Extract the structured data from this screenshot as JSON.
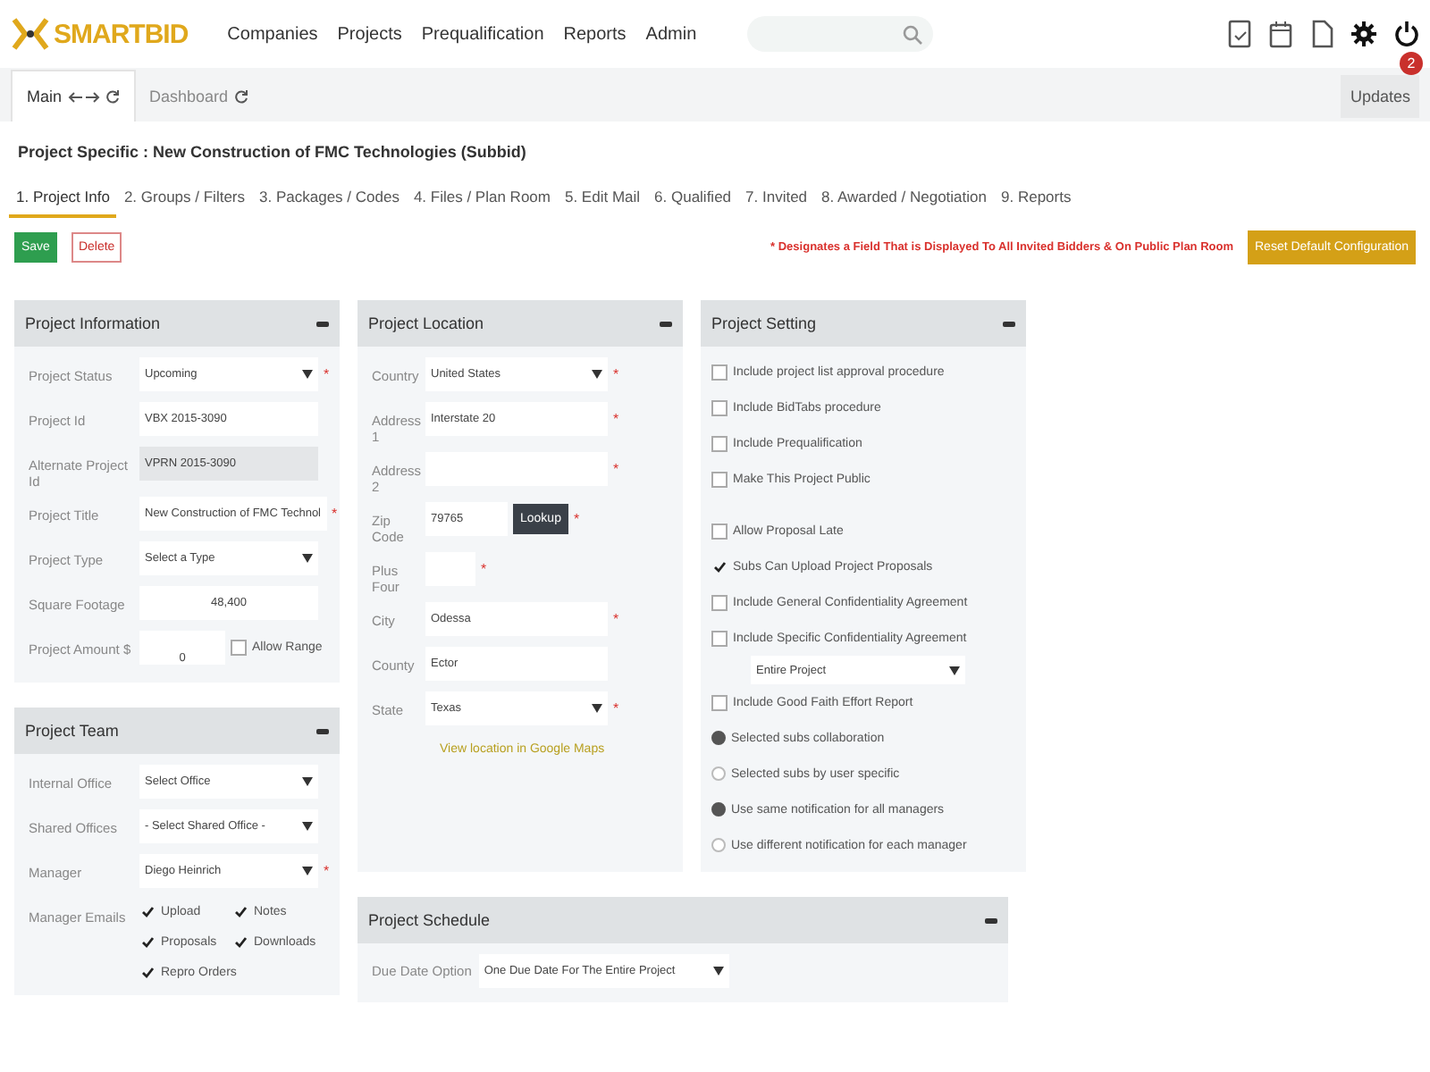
{
  "header": {
    "logo": "SMARTBID",
    "nav": [
      "Companies",
      "Projects",
      "Prequalification",
      "Reports",
      "Admin"
    ]
  },
  "window_tabs": [
    {
      "label": "Main",
      "selected": true,
      "arrows": true
    },
    {
      "label": "Dashboard",
      "selected": false,
      "arrows": false
    }
  ],
  "updates": {
    "label": "Updates",
    "badge": "2"
  },
  "project_title": "Project Specific : New Construction of FMC Technologies (Subbid)",
  "tabs": [
    {
      "label": "1. Project Info",
      "selected": true
    },
    {
      "label": "2. Groups / Filters",
      "selected": false
    },
    {
      "label": "3. Packages / Codes",
      "selected": false
    },
    {
      "label": "4. Files / Plan Room",
      "selected": false
    },
    {
      "label": "5. Edit Mail",
      "selected": false
    },
    {
      "label": "6. Qualified",
      "selected": false
    },
    {
      "label": "7. Invited",
      "selected": false
    },
    {
      "label": "8. Awarded / Negotiation",
      "selected": false
    },
    {
      "label": "9. Reports",
      "selected": false
    }
  ],
  "actions": {
    "save": "Save",
    "delete": "Delete",
    "notice": "* Designates a Field That is Displayed To All Invited Bidders & On Public Plan Room",
    "reset": "Reset Default Configuration"
  },
  "project_information": {
    "title": "Project Information",
    "fields": [
      {
        "kind": "select",
        "label": "Project Status",
        "value": "Upcoming",
        "mark": "*"
      },
      {
        "kind": "text",
        "label": "Project Id",
        "value": "VBX 2015-3090"
      },
      {
        "kind": "readonly",
        "label": "Alternate Project Id",
        "value": "VPRN 2015-3090"
      },
      {
        "kind": "text",
        "label": "Project Title",
        "value": "New Construction of FMC Technol",
        "mark": "*"
      },
      {
        "kind": "select",
        "label": "Project Type",
        "value": "Select a Type"
      },
      {
        "kind": "number",
        "label": "Square Footage",
        "value": "48,400"
      },
      {
        "kind": "amount",
        "label": "Project Amount $",
        "value": "0",
        "check": {
          "label": "Allow Range",
          "checked": false
        }
      }
    ]
  },
  "project_team": {
    "title": "Project Team",
    "fields": [
      {
        "kind": "select",
        "label": "Internal Office",
        "value": "Select Office"
      },
      {
        "kind": "select",
        "label": "Shared Offices",
        "value": "- Select Shared Office -"
      },
      {
        "kind": "select",
        "label": "Manager",
        "value": "Diego Heinrich",
        "mark": "*"
      },
      {
        "kind": "checks",
        "label": "Manager Emails",
        "options": [
          {
            "label": "Upload",
            "checked": true
          },
          {
            "label": "Notes",
            "checked": true
          },
          {
            "label": "Proposals",
            "checked": true
          },
          {
            "label": "Downloads",
            "checked": true
          },
          {
            "label": "Repro Orders",
            "checked": true
          }
        ]
      }
    ]
  },
  "project_location": {
    "title": "Project Location",
    "fields": [
      {
        "kind": "select",
        "label": "Country",
        "value": "United States",
        "mark": "*"
      },
      {
        "kind": "text",
        "label": "Address 1",
        "value": "Interstate 20",
        "mark": "*"
      },
      {
        "kind": "text",
        "label": "Address 2",
        "mark": "*"
      },
      {
        "kind": "lookup",
        "label": "Zip Code",
        "value": "79765",
        "button": "Lookup",
        "mark": "*"
      },
      {
        "kind": "short",
        "label": "Plus Four",
        "mark": "*"
      },
      {
        "kind": "text",
        "label": "City",
        "value": "Odessa",
        "mark": "*"
      },
      {
        "kind": "text",
        "label": "County",
        "value": "Ector"
      },
      {
        "kind": "select",
        "label": "State",
        "value": "Texas",
        "mark": "*"
      }
    ],
    "link": "View location in Google Maps"
  },
  "project_setting": {
    "title": "Project Setting",
    "items": [
      {
        "kind": "checkbox",
        "label": "Include project list approval procedure",
        "checked": false
      },
      {
        "kind": "checkbox",
        "label": "Include BidTabs procedure",
        "checked": false
      },
      {
        "kind": "checkbox",
        "label": "Include Prequalification",
        "checked": false
      },
      {
        "kind": "checkbox",
        "label": "Make This Project Public",
        "checked": false
      },
      {
        "kind": "checkbox",
        "label": "Allow Proposal Late",
        "checked": false
      },
      {
        "kind": "checkbox",
        "label": "Subs Can Upload Project Proposals",
        "checked": true
      },
      {
        "kind": "checkbox",
        "label": "Include General Confidentiality Agreement",
        "checked": false
      },
      {
        "kind": "checkbox",
        "label": "Include Specific Confidentiality Agreement",
        "checked": false
      },
      {
        "kind": "select",
        "label": "Entire Project"
      },
      {
        "kind": "checkbox",
        "label": "Include Good Faith Effort Report",
        "checked": false
      },
      {
        "kind": "radio",
        "label": "Selected subs collaboration",
        "checked": true
      },
      {
        "kind": "radio",
        "label": "Selected subs by user specific",
        "checked": false
      },
      {
        "kind": "radio",
        "label": "Use same notification for all managers",
        "checked": true
      },
      {
        "kind": "radio",
        "label": "Use different notification for each manager",
        "checked": false
      }
    ]
  },
  "project_schedule": {
    "title": "Project Schedule",
    "fields": [
      {
        "kind": "select",
        "label": "Due Date Option",
        "value": "One Due Date For The Entire Project"
      }
    ]
  }
}
